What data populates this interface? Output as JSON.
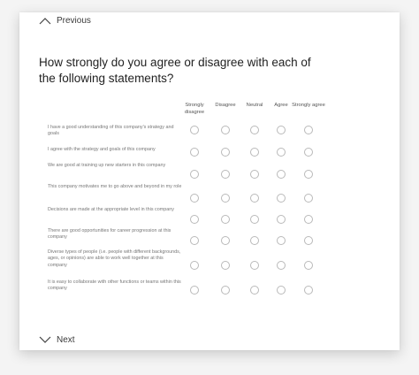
{
  "nav": {
    "previous_label": "Previous",
    "next_label": "Next"
  },
  "question": "How strongly do you agree or disagree with each of the following statements?",
  "scale": [
    "Strongly disagree",
    "Disagree",
    "Neutral",
    "Agree",
    "Strongly agree"
  ],
  "statements": [
    "I have a good understanding of this company's strategy and goals",
    "I agree with the strategy and goals of this company",
    "We are good at training up new starters in this company",
    "This company motivates me to go above and beyond in my role",
    "Decisions are made at the appropriate level in this company",
    "There are good opportunities for career progression at this company",
    "Diverse types of people (i.e. people with different backgrounds, ages, or opinions) are able to work well together at this company",
    "It is easy to collaborate with other functions or teams within this company"
  ]
}
